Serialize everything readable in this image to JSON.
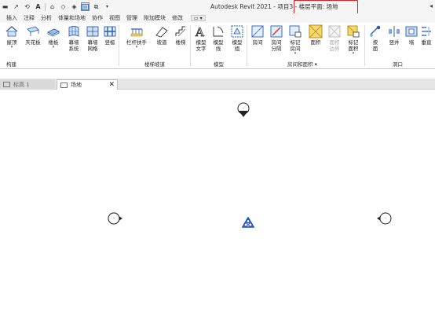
{
  "titlebar": {
    "app_title": "Autodesk Revit 2021 - 项目3 -",
    "view_title": "楼层平面: 场地"
  },
  "tabs": [
    {
      "label": "插入"
    },
    {
      "label": "注释"
    },
    {
      "label": "分析"
    },
    {
      "label": "体量和场地"
    },
    {
      "label": "协作"
    },
    {
      "label": "视图"
    },
    {
      "label": "管理"
    },
    {
      "label": "附加模块"
    },
    {
      "label": "修改"
    }
  ],
  "ribbon": {
    "buttons": [
      {
        "label": "屋顶",
        "sub": ""
      },
      {
        "label": "天花板",
        "sub": ""
      },
      {
        "label": "楼板",
        "sub": ""
      },
      {
        "label": "幕墙",
        "sub": "系统"
      },
      {
        "label": "幕墙",
        "sub": "网格"
      },
      {
        "label": "竖梃",
        "sub": ""
      },
      {
        "label": "栏杆扶手",
        "sub": ""
      },
      {
        "label": "坡道",
        "sub": ""
      },
      {
        "label": "楼梯",
        "sub": ""
      },
      {
        "label": "模型",
        "sub": "文字"
      },
      {
        "label": "模型",
        "sub": "线"
      },
      {
        "label": "模型",
        "sub": "组"
      },
      {
        "label": "房间",
        "sub": ""
      },
      {
        "label": "房间",
        "sub": "分隔"
      },
      {
        "label": "标记",
        "sub": "房间"
      },
      {
        "label": "面积",
        "sub": ""
      },
      {
        "label": "面积",
        "sub": "边界"
      },
      {
        "label": "标记",
        "sub": "面积"
      },
      {
        "label": "按",
        "sub": "面"
      },
      {
        "label": "竖井",
        "sub": ""
      },
      {
        "label": "墙",
        "sub": ""
      },
      {
        "label": "垂直",
        "sub": ""
      }
    ],
    "groups": {
      "build": "构建",
      "circulation": "楼梯坡道",
      "model": "模型",
      "room_area": "房间和面积",
      "opening": "洞口"
    }
  },
  "view_tabs": [
    {
      "label": "标高 1"
    },
    {
      "label": "场地"
    }
  ],
  "canvas": {
    "markers": {
      "north": "-",
      "west": "-",
      "east": "-"
    }
  },
  "colors": {
    "highlight": "#e02020",
    "survey_point": "#1f4fbf"
  }
}
